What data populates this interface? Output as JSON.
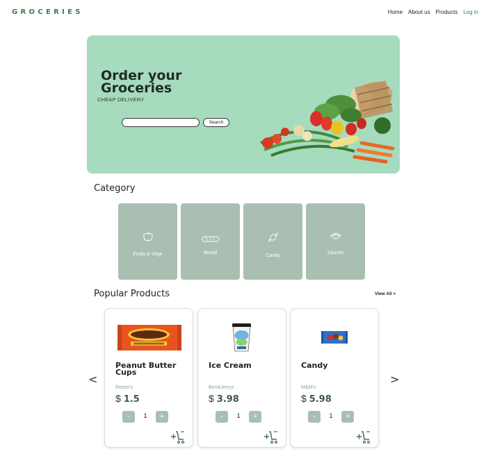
{
  "brand": {
    "logo_text": "GROCERIES"
  },
  "nav": {
    "home": "Home",
    "about": "About us",
    "products": "Products",
    "login": "Log in"
  },
  "hero": {
    "title": "Order your Groceries",
    "subtitle": "CHEAP DELIVERY",
    "search_placeholder": "",
    "search_value": "",
    "search_button": "Search"
  },
  "category": {
    "title": "Category",
    "items": [
      {
        "label": "Fruits & Vege",
        "icon": "apple-icon"
      },
      {
        "label": "Bread",
        "icon": "bread-icon"
      },
      {
        "label": "Candy",
        "icon": "candy-icon"
      },
      {
        "label": "Sauces",
        "icon": "bowl-icon"
      }
    ]
  },
  "popular": {
    "title": "Popular Products",
    "view_all": "View All >",
    "prev": "<",
    "next": ">",
    "products": [
      {
        "name": "Peanut Butter Cups",
        "brand": "Reese's",
        "currency": "$",
        "price": "1.5",
        "qty": "1",
        "minus": "-",
        "plus": "+"
      },
      {
        "name": "Ice Cream",
        "brand": "Ben&Jerrys",
        "currency": "$",
        "price": "3.98",
        "qty": "1",
        "minus": "-",
        "plus": "+"
      },
      {
        "name": "Candy",
        "brand": "M&M's",
        "currency": "$",
        "price": "5.98",
        "qty": "1",
        "minus": "-",
        "plus": "+"
      }
    ]
  },
  "colors": {
    "accent": "#3f7a4c",
    "hero_bg": "#a6dbbd",
    "category_bg": "#a9bfb1",
    "price": "#3e5a46"
  }
}
